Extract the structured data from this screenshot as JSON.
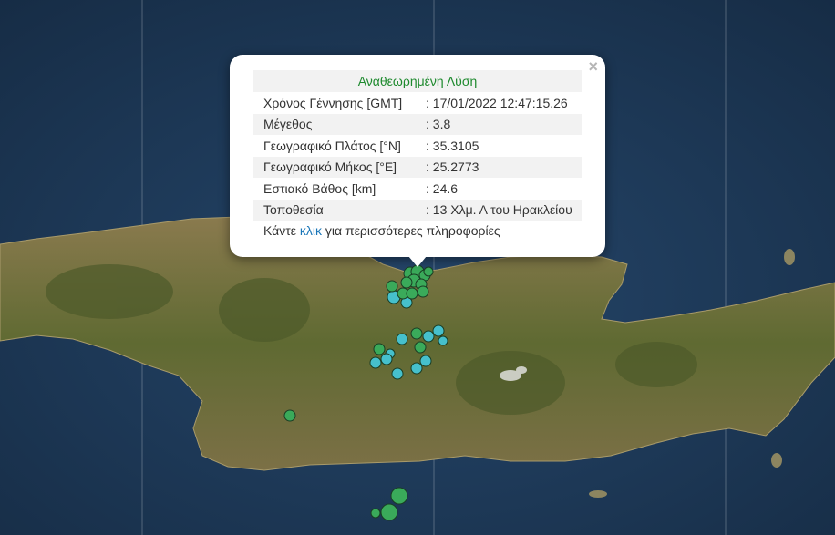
{
  "popup": {
    "title": "Αναθεωρημένη Λύση",
    "close_label": "×",
    "rows": [
      {
        "label": "Χρόνος Γέννησης [GMT]",
        "value": ": 17/01/2022 12:47:15.26"
      },
      {
        "label": "Μέγεθος",
        "value": ": 3.8"
      },
      {
        "label": "Γεωγραφικό Πλάτος [°N]",
        "value": ": 35.3105"
      },
      {
        "label": "Γεωγραφικό Μήκος [°E]",
        "value": ": 25.2773"
      },
      {
        "label": "Εστιακό Βάθος [km]",
        "value": ": 24.6"
      },
      {
        "label": "Τοποθεσία",
        "value": ": 13 Χλμ. Α του Ηρακλείου"
      }
    ],
    "more_prefix": "Κάντε ",
    "more_link": "κλικ",
    "more_suffix": " για περισσότερες πληροφορίες"
  },
  "colors": {
    "sea": "#1b3550",
    "land": "#6e6a3a",
    "quake_green": "#3aaa5a",
    "quake_cyan": "#46c0cc",
    "title_green": "#1e8a2e",
    "link_blue": "#1a76b8"
  }
}
